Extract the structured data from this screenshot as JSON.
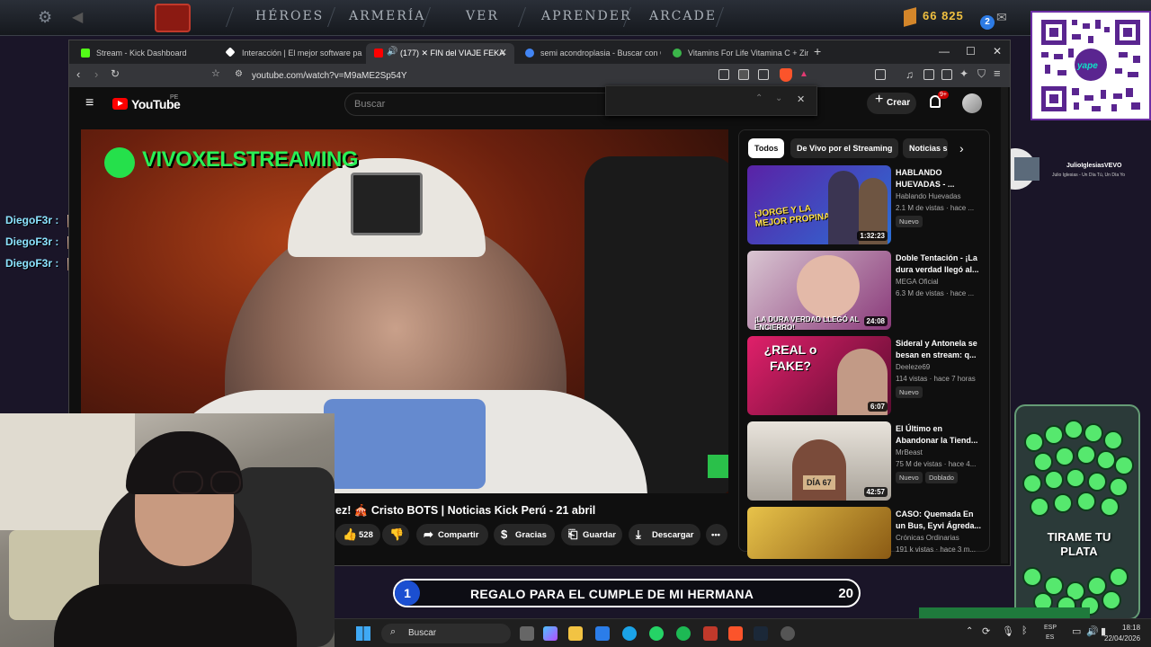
{
  "dota": {
    "nav": [
      "HÉROES",
      "ARMERÍA",
      "VER",
      "APRENDER",
      "ARCADE"
    ],
    "coins": "66 825",
    "badge": "2"
  },
  "qr": {
    "label": "yape"
  },
  "browser": {
    "tabs": [
      {
        "label": "Stream - Kick Dashboard",
        "color": "#53fc18"
      },
      {
        "label": "Interacción | El mejor software para p",
        "color": "#ffffff"
      },
      {
        "label": "(177) ✕ FIN del VIAJE FEKA",
        "color": "#ff0000",
        "active": true
      },
      {
        "label": "semi acondroplasia - Buscar con Goo",
        "color": "#4285f4"
      },
      {
        "label": "Vitamins For Life Vitamina C + Zinc N",
        "color": "#3bb54a"
      }
    ],
    "url": "youtube.com/watch?v=M9aME2Sp54Y",
    "shield_count": ""
  },
  "youtube": {
    "logo": "YouTube",
    "region": "PE",
    "search_placeholder": "Buscar",
    "create_label": "Crear",
    "notif_count": "9+",
    "channel_overlay": "VIVOXELSTREAMING",
    "video_title": "ez! 🎪 Cristo BOTS | Noticias Kick Perú - 21 abril",
    "likes": "528",
    "actions": [
      "Compartir",
      "Gracias",
      "Guardar",
      "Descargar"
    ],
    "chips": [
      "Todos",
      "De Vivo por el Streaming",
      "Noticias s"
    ],
    "recs": [
      {
        "title": "HABLANDO HUEVADAS - ...",
        "channel": "Hablando Huevadas",
        "views": "2.1 M de vistas · hace ...",
        "badge": "Nuevo",
        "dur": "1:32:23",
        "thumb_text": "¡JORGE Y LA MEJOR PROPINA!",
        "bg": "#4a1f8a"
      },
      {
        "title": "Doble Tentación - ¡La dura verdad llegó al...",
        "channel": "MEGA Oficial",
        "views": "6.3 M de vistas · hace ...",
        "badge": "",
        "dur": "24:08",
        "thumb_text": "¡LA DURA VERDAD LLEGÓ AL ENCIERRO!",
        "bg": "#8a3a7a"
      },
      {
        "title": "Sideral y Antonela se besan en stream: q...",
        "channel": "Deeleze69",
        "views": "114 vistas · hace 7 horas",
        "badge": "Nuevo",
        "dur": "6:07",
        "thumb_text": "¿REAL o FAKE?",
        "bg": "#b0164a"
      },
      {
        "title": "El Último en Abandonar la Tiend...",
        "channel": "MrBeast",
        "views": "75 M de vistas · hace 4...",
        "badge": "Nuevo",
        "badge2": "Doblado",
        "dur": "42:57",
        "thumb_text": "DÍA 67",
        "bg": "#c9c2b8"
      },
      {
        "title": "CASO: Quemada En un Bus, Eyvi Ágreda...",
        "channel": "Crónicas Ordinarias",
        "views": "191 k vistas · hace 3 m...",
        "badge": "",
        "dur": "",
        "thumb_text": "",
        "bg": "#d8a92a"
      }
    ]
  },
  "chat": [
    {
      "user": "DiegoF3r :"
    },
    {
      "user": "DiegoF3r :"
    },
    {
      "user": "DiegoF3r :"
    }
  ],
  "spotify": {
    "artist": "JulioIglesiasVEVO",
    "track": "Julio Iglesias - Un Día Tú, Un Día Yo"
  },
  "goal": {
    "rank": "1",
    "text": "REGALO PARA EL CUMPLE DE MI HERMANA",
    "count": "20"
  },
  "jar": {
    "text": "TIRAME TU PLATA"
  },
  "taskbar": {
    "search": "Buscar",
    "lang": "ESP",
    "region": "ES",
    "time": "18:18",
    "date": "22/04/2026"
  }
}
